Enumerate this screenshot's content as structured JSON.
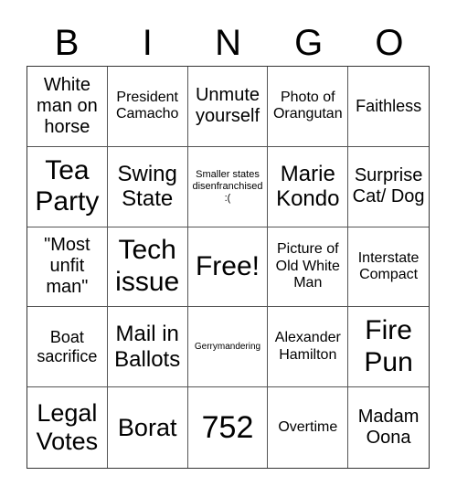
{
  "header": [
    "B",
    "I",
    "N",
    "G",
    "O"
  ],
  "cells": [
    "White man on horse",
    "President Camacho",
    "Unmute yourself",
    "Photo of Orangutan",
    "Faithless",
    "Tea Party",
    "Swing State",
    "Smaller states disenfranchised :(",
    "Marie Kondo",
    "Surprise Cat/ Dog",
    "\"Most unfit man\"",
    "Tech issue",
    "Free!",
    "Picture of Old White Man",
    "Interstate Compact",
    "Boat sacrifice",
    "Mail in Ballots",
    "Gerrymandering",
    "Alexander Hamilton",
    "Fire Pun",
    "Legal Votes",
    "Borat",
    "752",
    "Overtime",
    "Madam Oona"
  ]
}
